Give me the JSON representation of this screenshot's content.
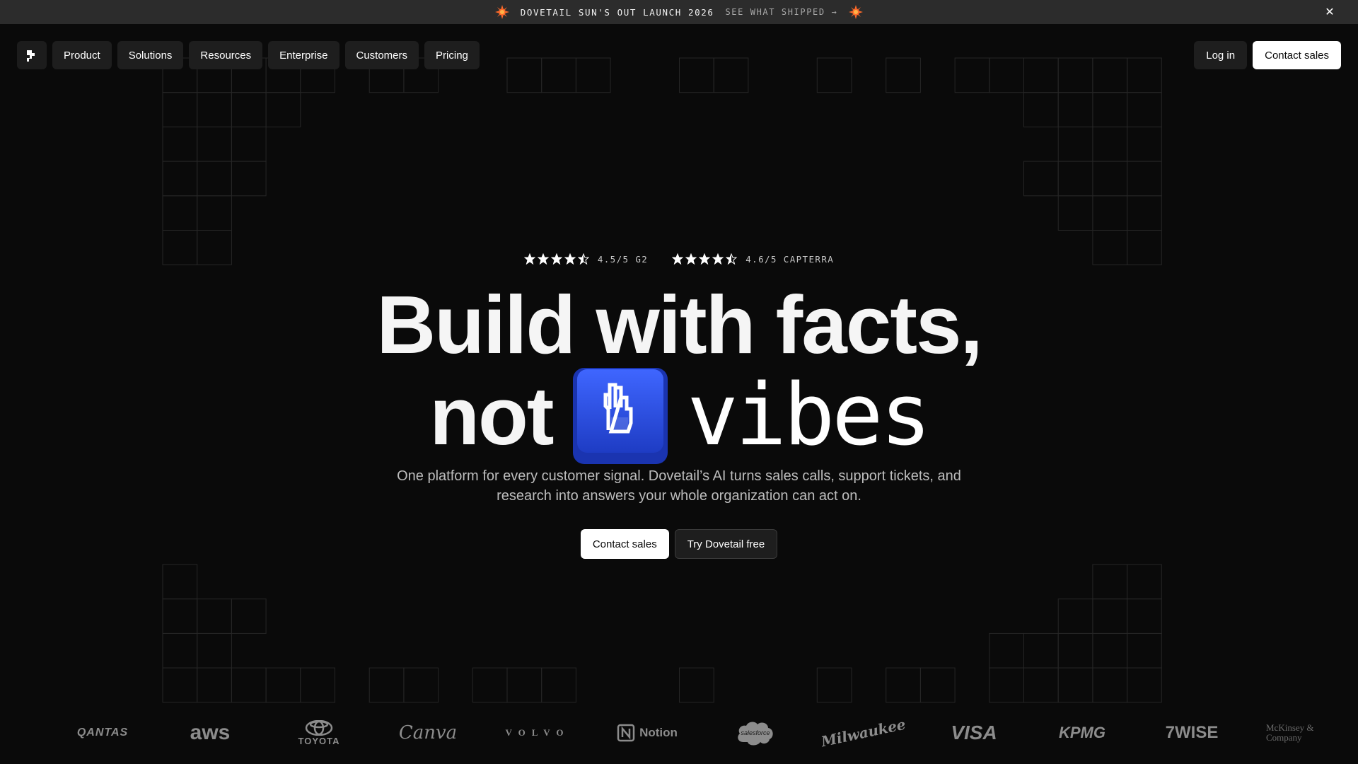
{
  "announcement": {
    "text": "DOVETAIL SUN'S OUT LAUNCH 2026",
    "link": "SEE WHAT SHIPPED →",
    "close_glyph": "✕",
    "icons": [
      "sun-icon",
      "sun-icon",
      "close-icon"
    ],
    "sun_color": "#ff6a2a"
  },
  "nav": {
    "logo_icon": "dovetail-logo-icon",
    "items": [
      "Product",
      "Solutions",
      "Resources",
      "Enterprise",
      "Customers",
      "Pricing"
    ],
    "login_label": "Log in",
    "contact_label": "Contact sales"
  },
  "hero": {
    "ratings": [
      {
        "stars": 4.5,
        "text": "4.5/5 G2"
      },
      {
        "stars": 4.5,
        "text": "4.6/5 CAPTERRA"
      }
    ],
    "headline_line1": "Build with facts,",
    "headline_not": "not",
    "headline_vibes": "vibes",
    "keycap_icon": "peace-hand-icon",
    "keycap_color": "#2f55e8",
    "subtitle": "One platform for every customer signal. Dovetail’s AI turns sales calls, support tickets, and research into answers your whole organization can act on.",
    "cta_primary": "Contact sales",
    "cta_secondary": "Try Dovetail free"
  },
  "logos": [
    {
      "name": "qantas",
      "text": "QANTAS"
    },
    {
      "name": "aws",
      "text": "aws"
    },
    {
      "name": "toyota",
      "text": "TOYOTA"
    },
    {
      "name": "canva",
      "text": "Canva"
    },
    {
      "name": "volvo",
      "text": "VOLVO"
    },
    {
      "name": "notion",
      "text": "Notion"
    },
    {
      "name": "salesforce",
      "text": "salesforce"
    },
    {
      "name": "milwaukee",
      "text": "Milwaukee"
    },
    {
      "name": "visa",
      "text": "VISA"
    },
    {
      "name": "kpmg",
      "text": "KPMG"
    },
    {
      "name": "wise",
      "text": "7WISE"
    },
    {
      "name": "mckinsey",
      "text": "McKinsey & Company"
    }
  ],
  "colors": {
    "background": "#0a0a0a",
    "announcement_bg": "#2c2c2c",
    "button_dark": "#1e1e1e",
    "button_light": "#ffffff",
    "logo_gray": "#8c8c8c"
  }
}
